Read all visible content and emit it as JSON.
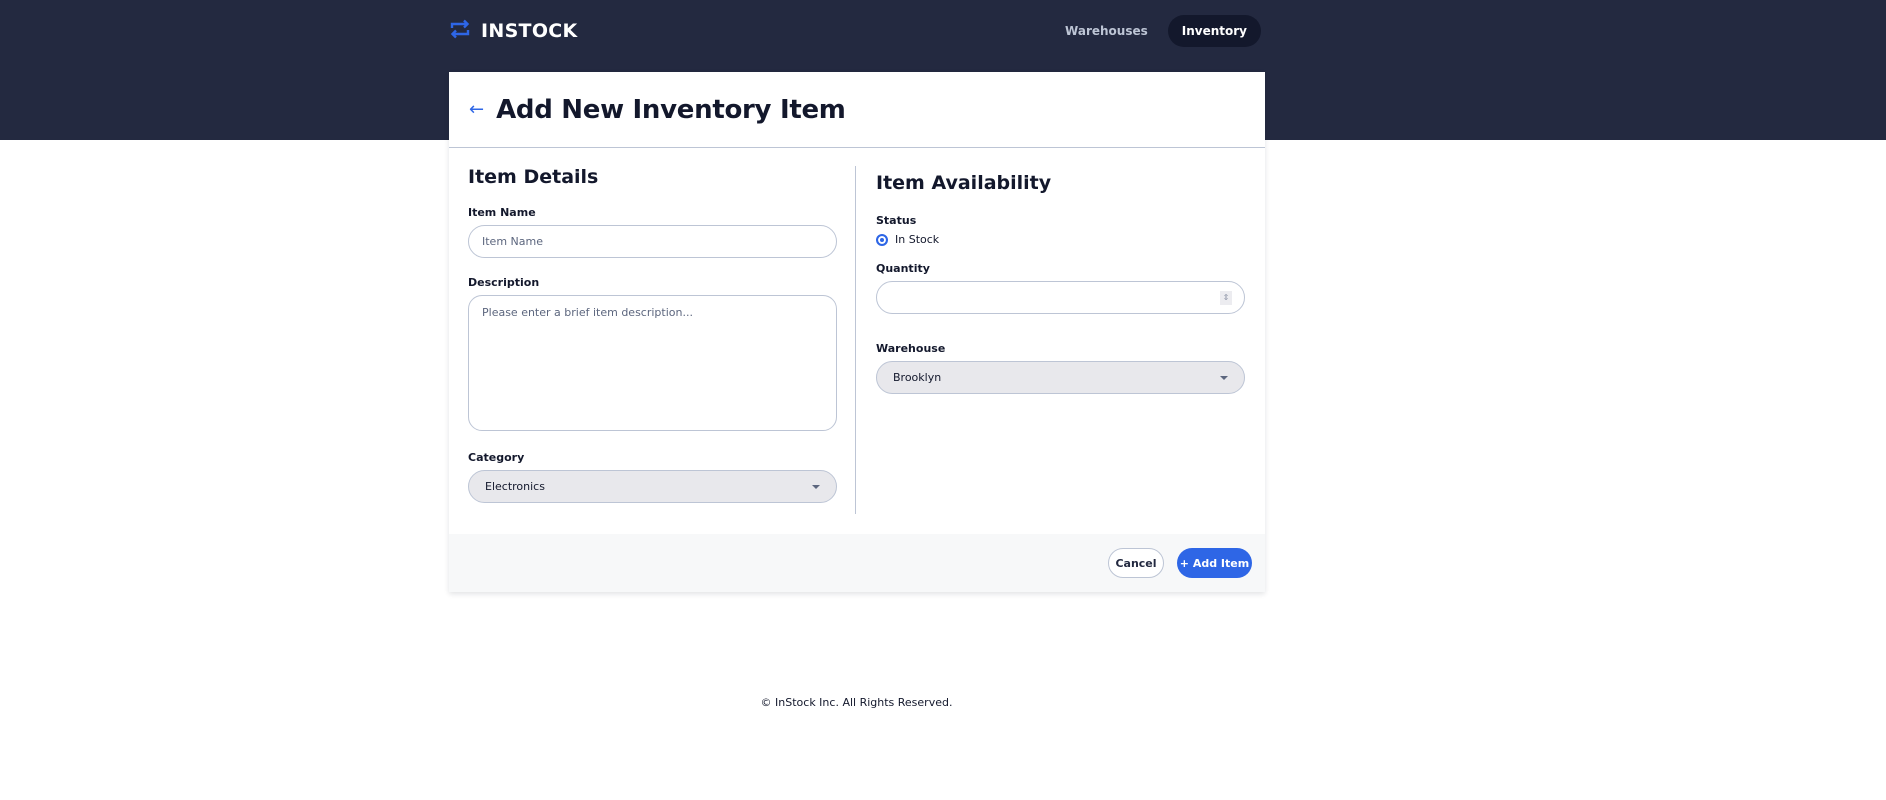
{
  "app": {
    "name": "INSTOCK",
    "logo_icon": "swap-arrows-icon"
  },
  "nav": {
    "items": [
      {
        "label": "Warehouses",
        "active": false
      },
      {
        "label": "Inventory",
        "active": true
      }
    ]
  },
  "page": {
    "back_icon": "arrow-left-icon",
    "title": "Add New Inventory Item"
  },
  "details": {
    "title": "Item Details",
    "item_name": {
      "label": "Item Name",
      "placeholder": "Item Name",
      "value": ""
    },
    "description": {
      "label": "Description",
      "placeholder": "Please enter a brief item description...",
      "value": ""
    },
    "category": {
      "label": "Category",
      "selected": "Electronics"
    }
  },
  "availability": {
    "title": "Item Availability",
    "status": {
      "label": "Status",
      "options": [
        {
          "label": "In Stock",
          "checked": true
        }
      ]
    },
    "quantity": {
      "label": "Quantity",
      "value": ""
    },
    "warehouse": {
      "label": "Warehouse",
      "selected": "Brooklyn"
    }
  },
  "actions": {
    "cancel": "Cancel",
    "add": "+ Add Item"
  },
  "footer": {
    "text": "© InStock Inc. All Rights Reserved."
  },
  "colors": {
    "header_bg": "#232940",
    "accent": "#2e66e6",
    "border": "#bdc5d5",
    "text": "#13182c"
  }
}
